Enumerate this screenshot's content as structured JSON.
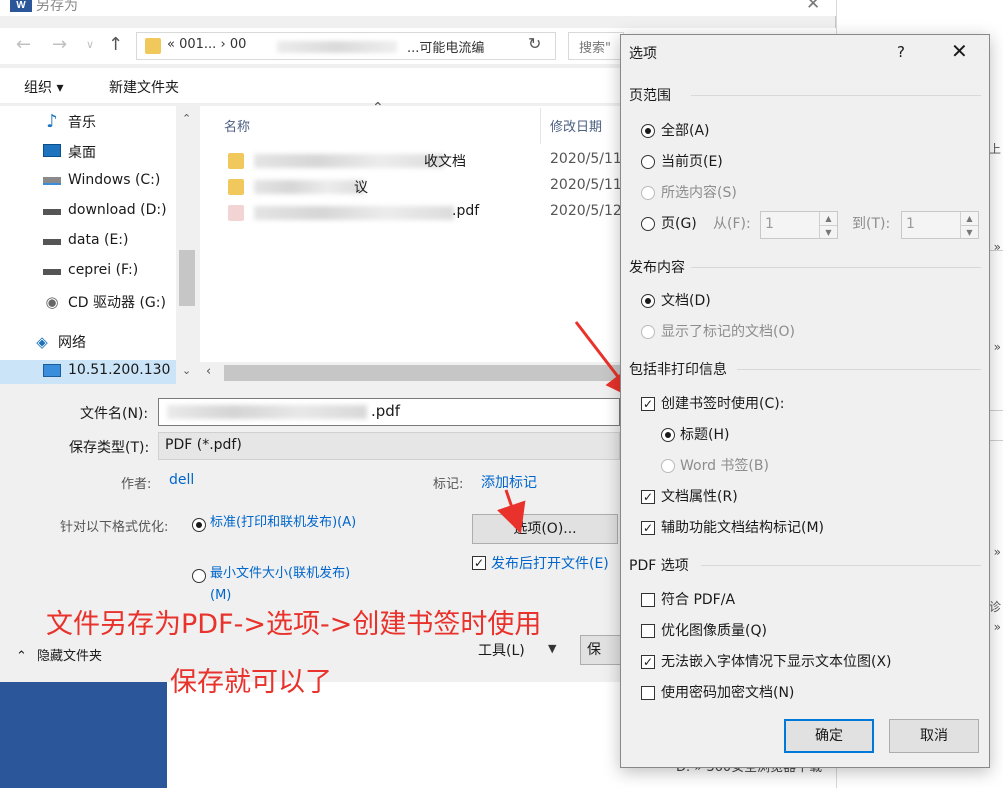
{
  "saveas": {
    "title": "另存为",
    "address": {
      "prefix": "«",
      "segment1": "001...",
      "sep": "›",
      "segment2": "00",
      "tail": "...可能电流编"
    },
    "search_placeholder": "搜索\"",
    "toolbar": {
      "organize": "组织 ▾",
      "new_folder": "新建文件夹"
    },
    "nav_items": [
      {
        "label": "音乐",
        "icon": "music-icon"
      },
      {
        "label": "桌面",
        "icon": "desktop-icon"
      },
      {
        "label": "Windows (C:)",
        "icon": "drive-icon"
      },
      {
        "label": "download (D:)",
        "icon": "drive-icon"
      },
      {
        "label": "data (E:)",
        "icon": "drive-icon"
      },
      {
        "label": "ceprei (F:)",
        "icon": "drive-icon"
      },
      {
        "label": "CD 驱动器 (G:)",
        "icon": "cd-drive-icon"
      },
      {
        "label": "网络",
        "icon": "network-icon"
      },
      {
        "label": "10.51.200.130",
        "icon": "computer-icon"
      }
    ],
    "columns": {
      "name": "名称",
      "date": "修改日期"
    },
    "files": [
      {
        "name_suffix": "收文档",
        "date": "2020/5/11"
      },
      {
        "name_suffix": "议",
        "date": "2020/5/11"
      },
      {
        "name_suffix": ".pdf",
        "date": "2020/5/12"
      }
    ],
    "filename_label": "文件名(N):",
    "filename_ext": ".pdf",
    "filetype_label": "保存类型(T):",
    "filetype_value": "PDF (*.pdf)",
    "author_label": "作者:",
    "author_value": "dell",
    "tags_label": "标记:",
    "tags_value": "添加标记",
    "optimize_label": "针对以下格式优化:",
    "optimize_standard": "标准(打印和联机发布)(A)",
    "optimize_minimal": "最小文件大小(联机发布)(M)",
    "options_button": "选项(O)...",
    "open_after": "发布后打开文件(E)",
    "tools": "工具(L)",
    "save_partial": "保",
    "hide_folders": "隐藏文件夹"
  },
  "annotations": {
    "line1": "文件另存为PDF->选项->创建书签时使用",
    "line2": "保存就可以了"
  },
  "background": {
    "bottom_text": "D. » 360安全浏览器下载"
  },
  "options": {
    "title": "选项",
    "help": "?",
    "page_range": {
      "heading": "页范围",
      "all": "全部(A)",
      "current": "当前页(E)",
      "selection": "所选内容(S)",
      "pages": "页(G)",
      "from_label": "从(F):",
      "from_value": "1",
      "to_label": "到(T):",
      "to_value": "1"
    },
    "publish": {
      "heading": "发布内容",
      "document": "文档(D)",
      "markup": "显示了标记的文档(O)"
    },
    "nonprint": {
      "heading": "包括非打印信息",
      "bookmarks": "创建书签时使用(C):",
      "headings": "标题(H)",
      "word_bookmarks": "Word 书签(B)",
      "properties": "文档属性(R)",
      "structure": "辅助功能文档结构标记(M)"
    },
    "pdf": {
      "heading": "PDF 选项",
      "pdfa": "符合 PDF/A",
      "optimize_images": "优化图像质量(Q)",
      "bitmap_text": "无法嵌入字体情况下显示文本位图(X)",
      "encrypt": "使用密码加密文档(N)"
    },
    "ok": "确定",
    "cancel": "取消"
  },
  "colors": {
    "accent": "#0078d7",
    "annotation": "#e8322b",
    "link": "#0066cc",
    "word_blue": "#2b579a"
  }
}
